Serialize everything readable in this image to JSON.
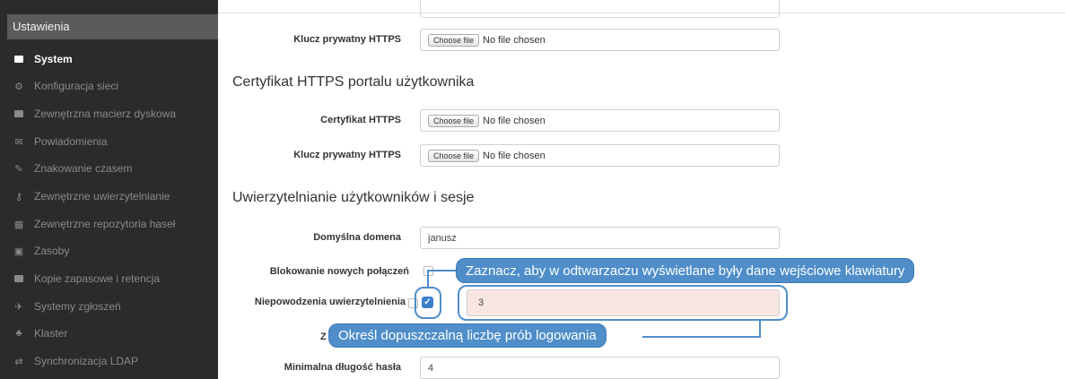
{
  "sidebar": {
    "title": "Ustawienia",
    "items": [
      {
        "label": "System",
        "icon": "folder-icon",
        "active": true
      },
      {
        "label": "Konfiguracja sieci",
        "icon": "gears-icon"
      },
      {
        "label": "Zewnętrzna macierz dyskowa",
        "icon": "drive-icon"
      },
      {
        "label": "Powiadomienia",
        "icon": "envelope-icon"
      },
      {
        "label": "Znakowanie czasem",
        "icon": "edit-icon"
      },
      {
        "label": "Zewnętrzne uwierzytelnianie",
        "icon": "key-icon"
      },
      {
        "label": "Zewnętrzne repozytoria haseł",
        "icon": "grid-icon"
      },
      {
        "label": "Zasoby",
        "icon": "image-icon"
      },
      {
        "label": "Kopie zapasowe i retencja",
        "icon": "archive-icon"
      },
      {
        "label": "Systemy zgłoszeń",
        "icon": "plane-icon"
      },
      {
        "label": "Klaster",
        "icon": "sitemap-icon"
      },
      {
        "label": "Synchronizacja LDAP",
        "icon": "exchange-icon"
      }
    ]
  },
  "main": {
    "row_private_key_top": {
      "label": "Klucz prywatny HTTPS",
      "button": "Choose file",
      "file": "No file chosen"
    },
    "section_user_portal": "Certyfikat HTTPS portalu użytkownika",
    "row_cert": {
      "label": "Certyfikat HTTPS",
      "button": "Choose file",
      "file": "No file chosen"
    },
    "row_private_key": {
      "label": "Klucz prywatny HTTPS",
      "button": "Choose file",
      "file": "No file chosen"
    },
    "section_auth": "Uwierzytelnianie użytkowników i sesje",
    "default_domain": {
      "label": "Domyślna domena",
      "value": "janusz"
    },
    "block_connections": {
      "label": "Blokowanie nowych połączeń"
    },
    "auth_failures": {
      "label": "Niepowodzenia uwierzytelnienia",
      "value": "3"
    },
    "partial_label": "Z",
    "min_password": {
      "label": "Minimalna długość hasła",
      "value": "4"
    }
  },
  "callouts": {
    "top": "Zaznacz, aby w odtwarzaczu wyświetlane były dane wejściowe klawiatury",
    "bottom": "Określ dopuszczalną liczbę prób logowania"
  },
  "colors": {
    "callout": "#4f8ec9",
    "sidebar": "#2b2b2b",
    "highlight": "#f7e6e2"
  }
}
